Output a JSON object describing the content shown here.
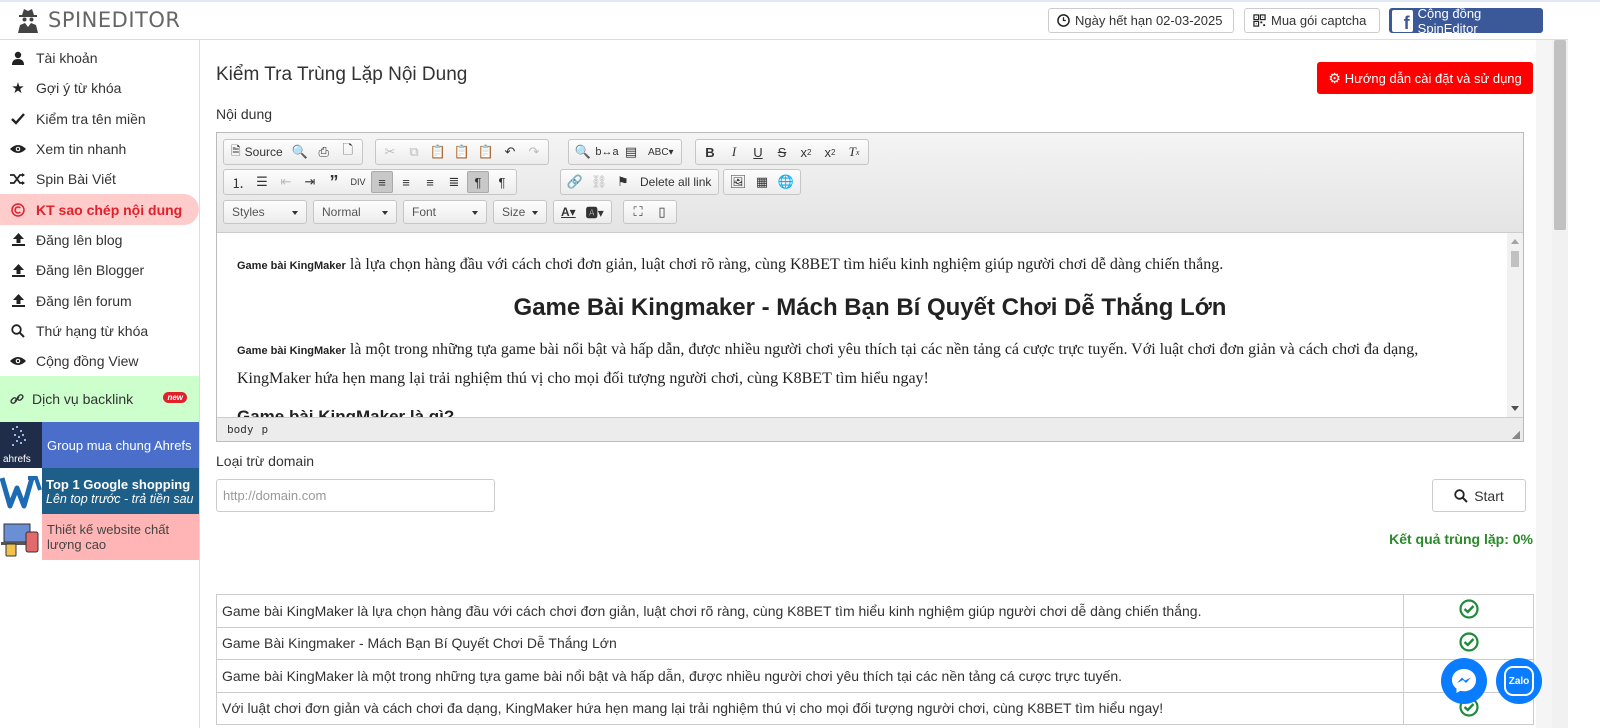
{
  "app": {
    "logo_text": "SPINEDITOR"
  },
  "topbar": {
    "expiry": "Ngày hết hạn 02-03-2025",
    "captcha": "Mua gói captcha",
    "community": "Cộng đồng SpinEditor"
  },
  "sidebar": {
    "items": [
      {
        "label": "Tài khoản",
        "icon": "user-icon"
      },
      {
        "label": "Gợi ý từ khóa",
        "icon": "star-icon"
      },
      {
        "label": "Kiểm tra tên miền",
        "icon": "check-icon"
      },
      {
        "label": "Xem tin nhanh",
        "icon": "eye-icon"
      },
      {
        "label": "Spin Bài Viết",
        "icon": "shuffle-icon"
      },
      {
        "label": "KT sao chép nội dung",
        "icon": "copyright-icon",
        "active": true
      },
      {
        "label": "Đăng lên blog",
        "icon": "upload-icon"
      },
      {
        "label": "Đăng lên Blogger",
        "icon": "upload-icon"
      },
      {
        "label": "Đăng lên forum",
        "icon": "upload-icon"
      },
      {
        "label": "Thứ hạng từ khóa",
        "icon": "search-icon"
      },
      {
        "label": "Cộng đồng View",
        "icon": "eye-icon"
      }
    ],
    "backlink": {
      "label": "Dịch vụ backlink",
      "badge": "new"
    },
    "promos": [
      {
        "label": "Group mua chung Ahrefs",
        "logo": "ahrefs"
      },
      {
        "title": "Top 1 Google shopping",
        "subtitle": "Lên top trước - trả tiền sau"
      },
      {
        "label": "Thiết kế website chất lượng cao"
      }
    ]
  },
  "main": {
    "title": "Kiểm Tra Trùng Lặp Nội Dung",
    "help_button": "Hướng dẫn cài đặt và sử dụng",
    "content_label": "Nội dung",
    "exclude_label": "Loại trừ domain",
    "domain_placeholder": "http://domain.com",
    "start_button": "Start",
    "result": "Kết quả trùng lặp: 0%"
  },
  "editor": {
    "source_label": "Source",
    "delete_links_label": "Delete all link",
    "combos": [
      "Styles",
      "Normal",
      "Font",
      "Size"
    ],
    "path": [
      "body",
      "p"
    ],
    "content": {
      "p1_keyword": "Game bài KingMaker",
      "p1_text": " là lựa chọn hàng đầu với cách chơi đơn giản, luật chơi rõ ràng, cùng K8BET tìm hiểu kinh nghiệm giúp người chơi dễ dàng chiến thắng.",
      "heading": "Game Bài Kingmaker - Mách Bạn Bí Quyết Chơi Dễ Thắng Lớn",
      "p2_keyword": "Game bài KingMaker",
      "p2_text": " là một trong những tựa game bài nổi bật và hấp dẫn, được nhiều người chơi yêu thích tại các nền tảng cá cược trực tuyến. Với luật chơi đơn giản và cách chơi đa dạng, KingMaker hứa hẹn mang lại trải nghiệm thú vị cho mọi đối tượng người chơi, cùng K8BET tìm hiểu ngay!",
      "subheading": "Game bài KingMaker là gì?"
    }
  },
  "results": [
    "Game bài KingMaker là lựa chọn hàng đầu với cách chơi đơn giản, luật chơi rõ ràng, cùng K8BET tìm hiểu kinh nghiệm giúp người chơi dễ dàng chiến thắng.",
    "Game Bài Kingmaker - Mách Bạn Bí Quyết Chơi Dễ Thắng Lớn",
    "Game bài KingMaker là một trong những tựa game bài nổi bật và hấp dẫn, được nhiều người chơi yêu thích tại các nền tảng cá cược trực tuyến.",
    "Với luật chơi đơn giản và cách chơi đa dạng, KingMaker hứa hẹn mang lại trải nghiệm thú vị cho mọi đối tượng người chơi, cùng K8BET tìm hiểu ngay!"
  ],
  "colors": {
    "accent_red": "#ff0000",
    "active_bg": "#ffcccc",
    "success_green": "#2a8a2a",
    "facebook": "#3b5998"
  },
  "floating": {
    "messenger": "messenger-icon",
    "zalo": "Zalo"
  }
}
